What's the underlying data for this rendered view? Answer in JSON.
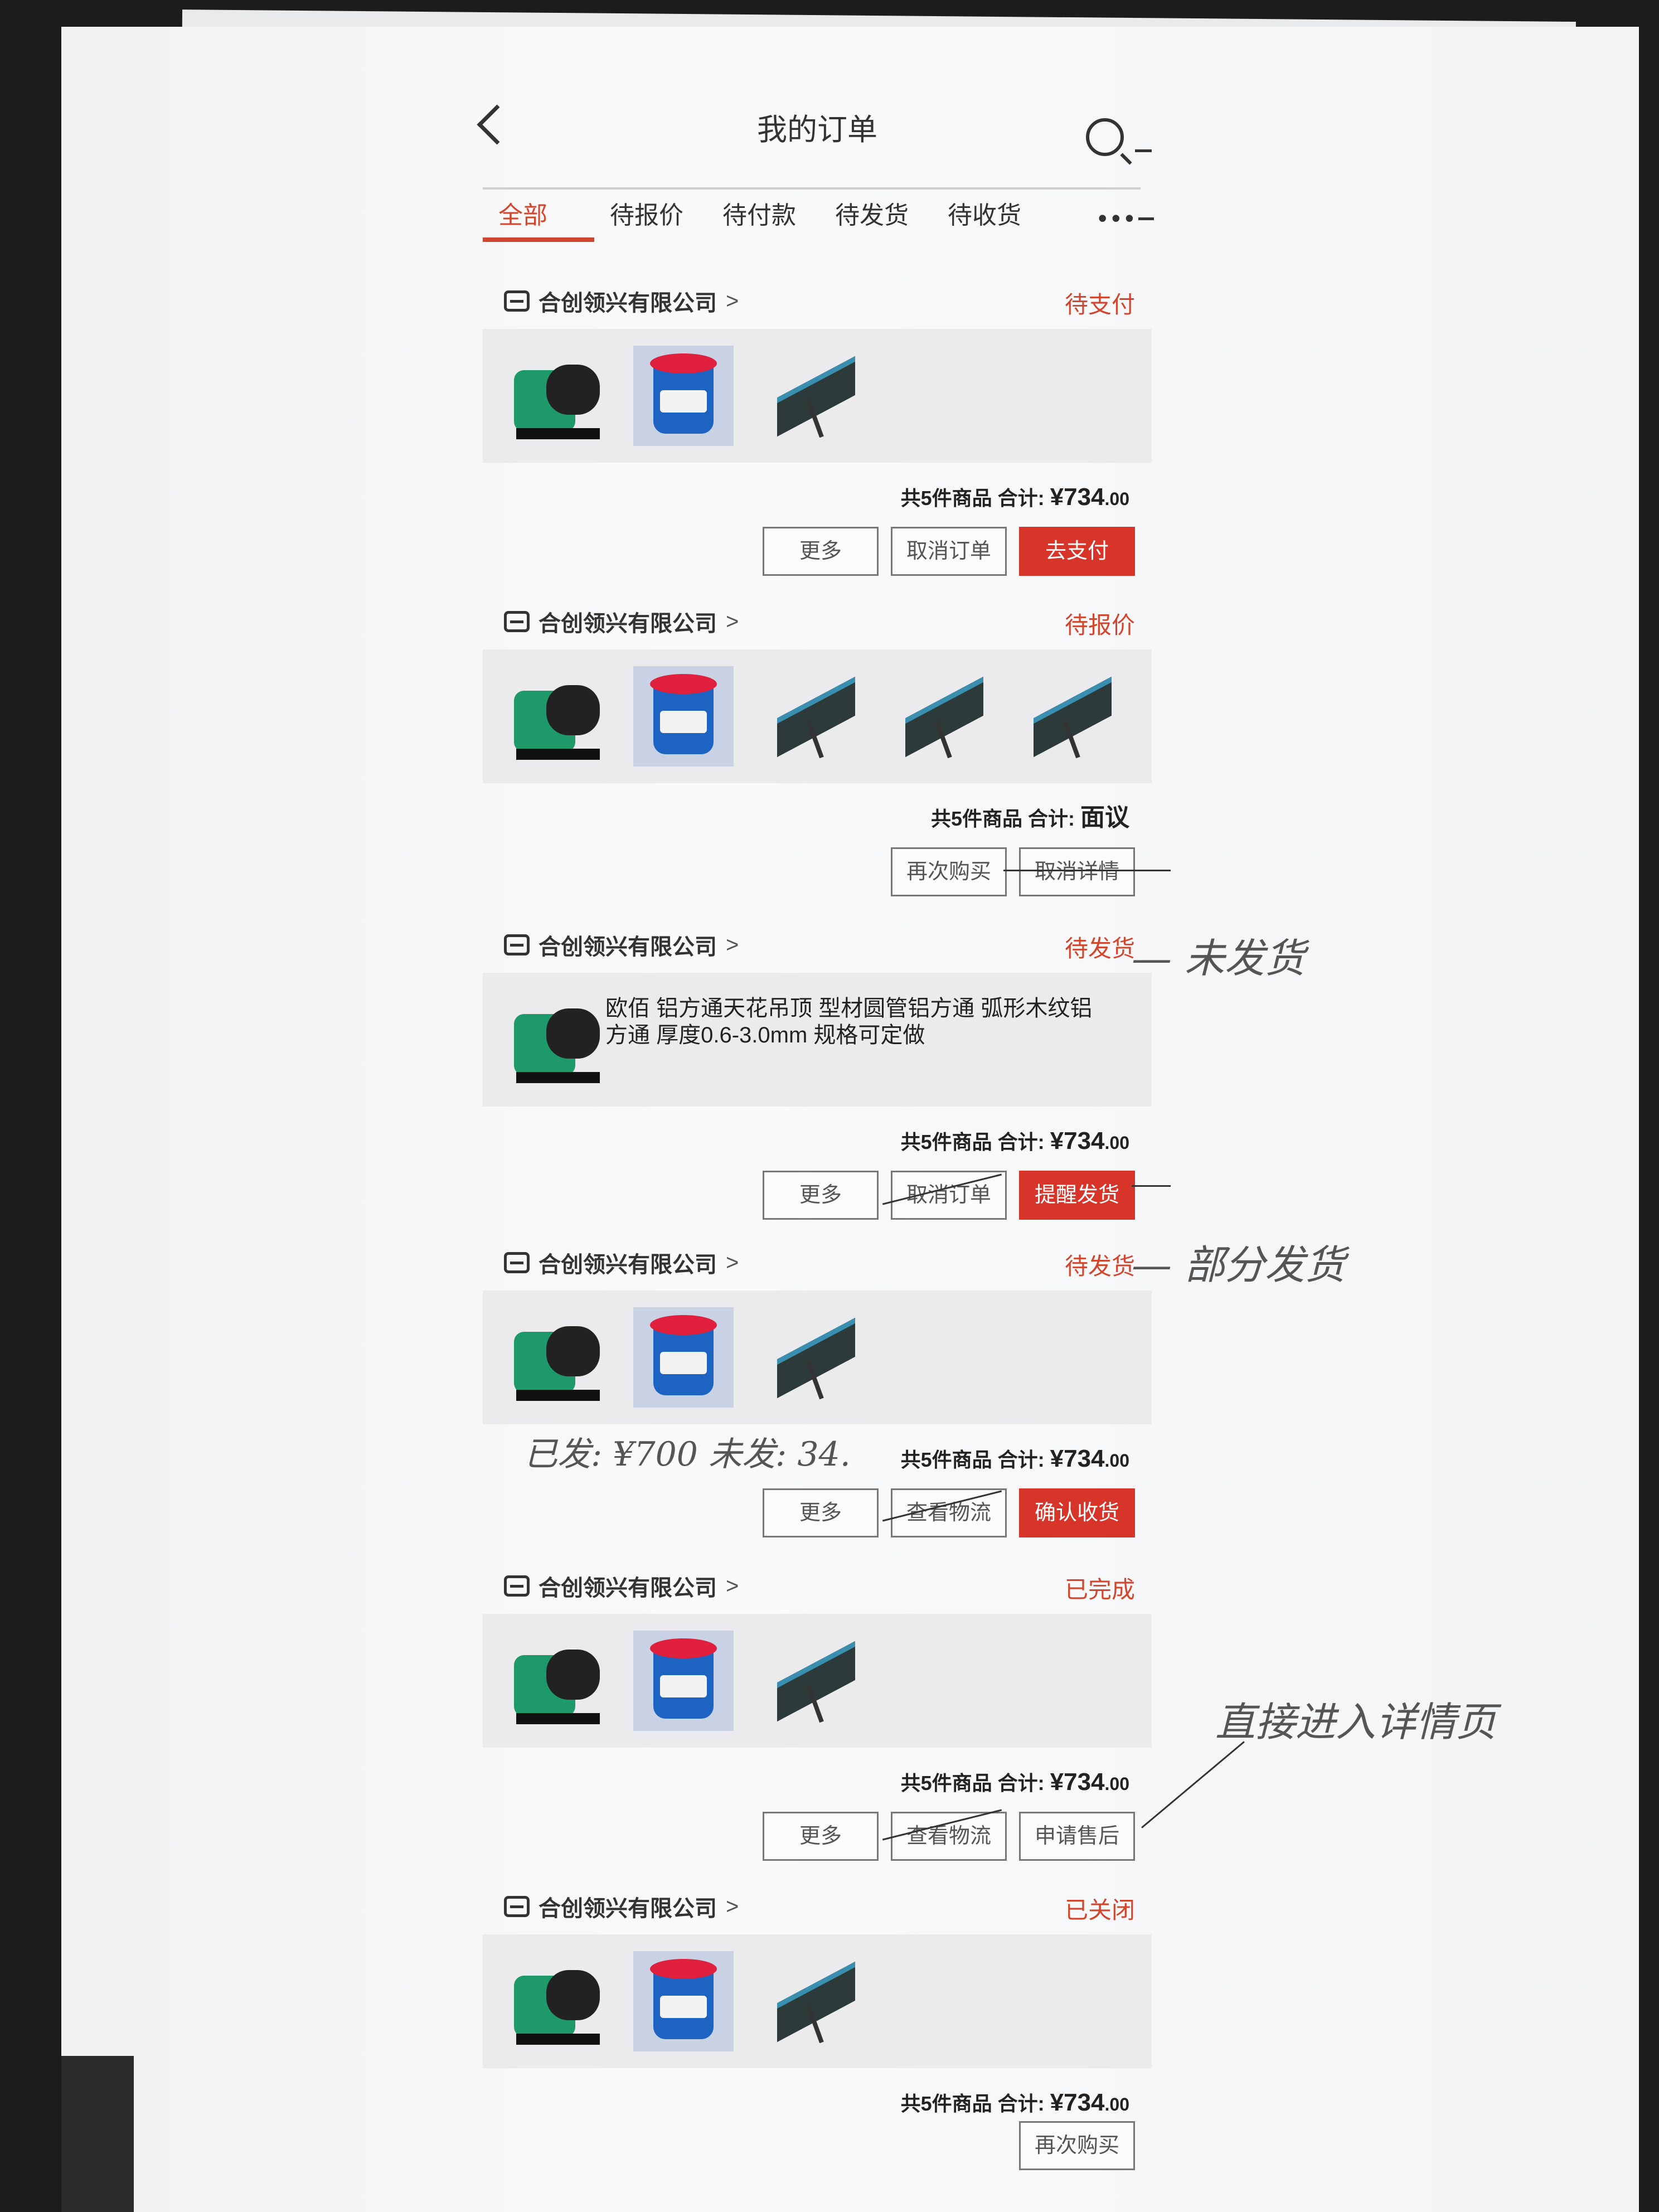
{
  "header": {
    "title": "我的订单"
  },
  "tabs": [
    {
      "label": "全部",
      "active": true
    },
    {
      "label": "待报价"
    },
    {
      "label": "待付款"
    },
    {
      "label": "待发货"
    },
    {
      "label": "待收货"
    }
  ],
  "tabs_more": "•••",
  "orders": [
    {
      "shop": "合创领兴有限公司",
      "status": "待支付",
      "summary": "共5件商品 合计: ",
      "currency": "¥",
      "amount_int": "734",
      "amount_dec": ".00",
      "buttons": [
        "更多",
        "取消订单",
        "去支付"
      ]
    },
    {
      "shop": "合创领兴有限公司",
      "status": "待报价",
      "summary": "共5件商品 合计: ",
      "amount_text": "面议",
      "buttons": [
        "再次购买",
        "取消详情"
      ]
    },
    {
      "shop": "合创领兴有限公司",
      "status": "待发货",
      "summary": "共5件商品 合计: ",
      "currency": "¥",
      "amount_int": "734",
      "amount_dec": ".00",
      "description": "欧佰 铝方通天花吊顶 型材圆管铝方通 弧形木纹铝方通 厚度0.6-3.0mm 规格可定做",
      "buttons": [
        "更多",
        "取消订单",
        "提醒发货"
      ]
    },
    {
      "shop": "合创领兴有限公司",
      "status": "待发货",
      "summary": "共5件商品 合计: ",
      "currency": "¥",
      "amount_int": "734",
      "amount_dec": ".00",
      "buttons": [
        "更多",
        "查看物流",
        "确认收货"
      ]
    },
    {
      "shop": "合创领兴有限公司",
      "status": "已完成",
      "summary": "共5件商品 合计: ",
      "currency": "¥",
      "amount_int": "734",
      "amount_dec": ".00",
      "buttons": [
        "更多",
        "查看物流",
        "申请售后"
      ]
    },
    {
      "shop": "合创领兴有限公司",
      "status": "已关闭",
      "summary": "共5件商品 合计: ",
      "currency": "¥",
      "amount_int": "734",
      "amount_dec": ".00",
      "buttons": [
        "再次购买"
      ]
    }
  ],
  "annotations": {
    "not_shipped": "— 未发货",
    "partial": "— 部分发货",
    "shipped_note": "已发: ¥700   未发: 34.",
    "detail_note": "直接进入详情页"
  },
  "colors": {
    "accent": "#d2462e",
    "button_red": "#d7352a"
  }
}
